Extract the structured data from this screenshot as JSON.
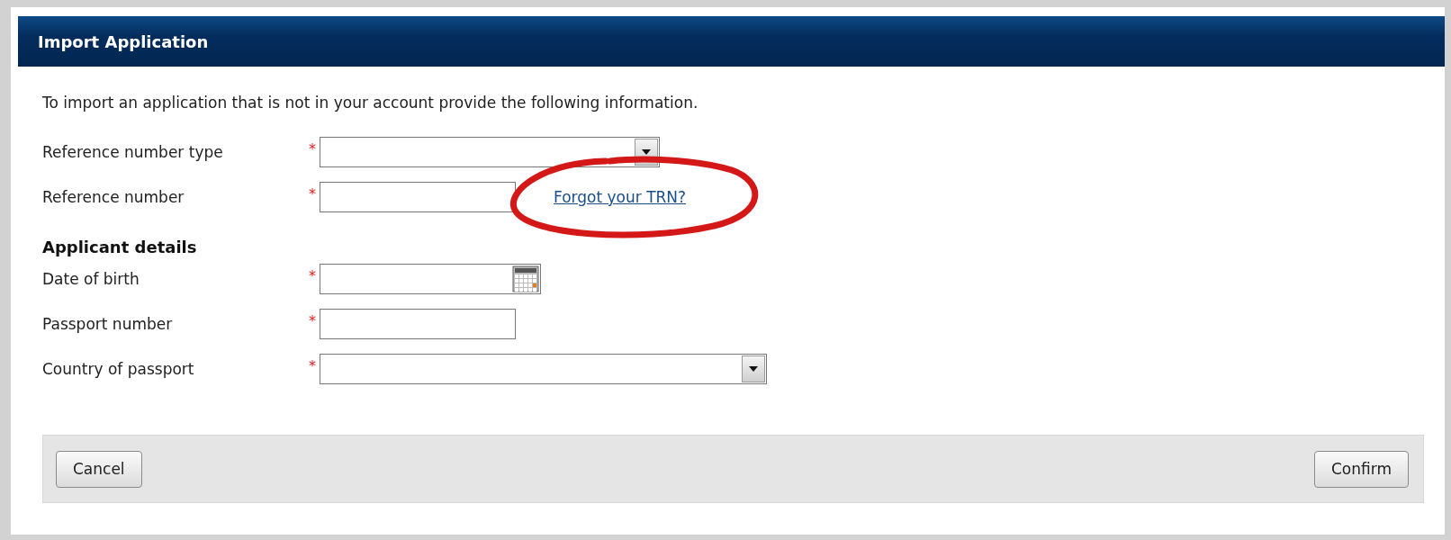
{
  "window": {
    "title": "Import Application"
  },
  "intro": "To import an application that is not in your account provide the following information.",
  "reference_fields": [
    {
      "label": "Reference number type",
      "marker": "*",
      "kind": "select"
    },
    {
      "label": "Reference number",
      "marker": "*",
      "kind": "text",
      "link": {
        "label": "Forgot your TRN?",
        "highlighted": true
      }
    }
  ],
  "applicant_section": {
    "heading": "Applicant details",
    "fields": [
      {
        "label": "Date of birth",
        "marker": "*",
        "kind": "date"
      },
      {
        "label": "Passport number",
        "marker": "*",
        "kind": "text"
      },
      {
        "label": "Country of passport",
        "marker": "*",
        "kind": "select-wide"
      }
    ]
  },
  "buttons": [
    {
      "label": "Cancel"
    },
    {
      "label": "Confirm"
    }
  ]
}
